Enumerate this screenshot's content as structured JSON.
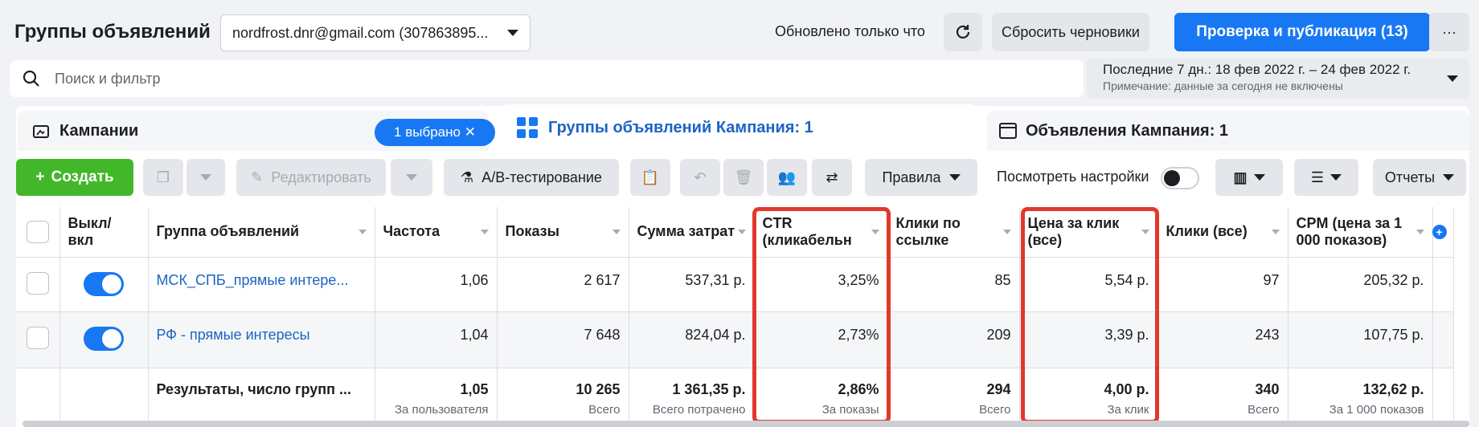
{
  "header": {
    "title": "Группы объявлений",
    "account": "nordfrost.dnr@gmail.com (307863895...",
    "updated": "Обновлено только что",
    "reset": "Сбросить черновики",
    "publish": "Проверка и публикация (13)",
    "more": "···"
  },
  "search": {
    "placeholder": "Поиск и фильтр"
  },
  "date": {
    "range": "Последние 7 дн.: 18 фев 2022 г. – 24 фев 2022 г.",
    "note": "Примечание: данные за сегодня не включены"
  },
  "tabs": {
    "campaigns": "Кампании",
    "selected": "1 выбрано",
    "adsets": "Группы объявлений Кампания: 1",
    "ads": "Объявления Кампания: 1"
  },
  "toolbar": {
    "create": "Создать",
    "edit": "Редактировать",
    "ab": "A/B-тестирование",
    "rules": "Правила",
    "view_settings": "Посмотреть настройки",
    "reports": "Отчеты"
  },
  "columns": [
    "Выкл/ вкл",
    "Группа объявлений",
    "Частота",
    "Показы",
    "Сумма затрат",
    "CTR (кликабельн",
    "Клики по ссылке",
    "Цена за клик (все)",
    "Клики (все)",
    "CPM (цена за 1 000 показов)"
  ],
  "rows": [
    {
      "name": "МСК_СПБ_прямые интере...",
      "freq": "1,06",
      "impr": "2 617",
      "spend": "537,31 р.",
      "ctr": "3,25%",
      "link_clicks": "85",
      "cpc": "5,54 р.",
      "clicks": "97",
      "cpm": "205,32 р."
    },
    {
      "name": "РФ - прямые интересы",
      "freq": "1,04",
      "impr": "7 648",
      "spend": "824,04 р.",
      "ctr": "2,73%",
      "link_clicks": "209",
      "cpc": "3,39 р.",
      "clicks": "243",
      "cpm": "107,75 р."
    }
  ],
  "totals": {
    "name": "Результаты, число групп ...",
    "freq": "1,05",
    "freq_sub": "За пользователя",
    "impr": "10 265",
    "impr_sub": "Всего",
    "spend": "1 361,35 р.",
    "spend_sub": "Всего потрачено",
    "ctr": "2,86%",
    "ctr_sub": "За показы",
    "link_clicks": "294",
    "link_sub": "Всего",
    "cpc": "4,00 р.",
    "cpc_sub": "За клик",
    "clicks": "340",
    "clicks_sub": "Всего",
    "cpm": "132,62 р.",
    "cpm_sub": "За 1 000 показов"
  },
  "colors": {
    "accent": "#1877f2",
    "create": "#42b72a",
    "highlight": "#e0392b"
  }
}
